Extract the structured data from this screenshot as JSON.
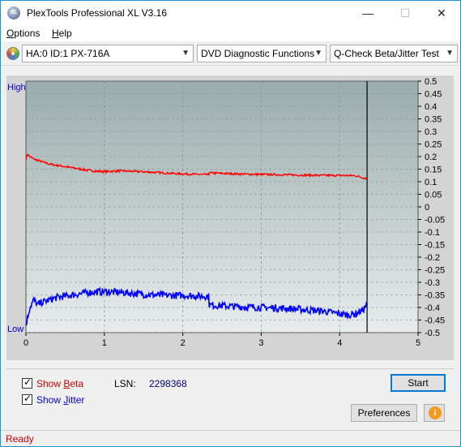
{
  "window": {
    "title": "PlexTools Professional XL V3.16",
    "icon_text": "XL",
    "minimize": "—",
    "maximize": "☐",
    "close": "✕"
  },
  "menu": {
    "items": [
      {
        "label": "Options",
        "accel": "O"
      },
      {
        "label": "Help",
        "accel": "H"
      }
    ]
  },
  "toolbar": {
    "drive": "HA:0 ID:1  PX-716A",
    "function": "DVD Diagnostic Functions",
    "test": "Q-Check Beta/Jitter Test",
    "arrow": "▼"
  },
  "chart_labels": {
    "high": "High",
    "low": "Low"
  },
  "chart_data": {
    "type": "line",
    "x_ticks": [
      0,
      1,
      2,
      3,
      4,
      5
    ],
    "y_ticks_right": [
      0.5,
      0.45,
      0.4,
      0.35,
      0.3,
      0.25,
      0.2,
      0.15,
      0.1,
      0.05,
      0,
      -0.05,
      -0.1,
      -0.15,
      -0.2,
      -0.25,
      -0.3,
      -0.35,
      -0.4,
      -0.45,
      -0.5
    ],
    "xlim": [
      0,
      5
    ],
    "ylim": [
      -0.5,
      0.5
    ],
    "end_marker_x": 4.35,
    "grid": true,
    "series": [
      {
        "key": "beta",
        "color": "#ff0000",
        "x": [
          0.0,
          0.02,
          0.05,
          0.1,
          0.15,
          0.2,
          0.3,
          0.4,
          0.5,
          0.6,
          0.7,
          0.8,
          0.9,
          1.0,
          1.2,
          1.4,
          1.6,
          1.8,
          2.0,
          2.2,
          2.33,
          2.34,
          2.6,
          2.8,
          3.0,
          3.2,
          3.4,
          3.6,
          3.8,
          4.0,
          4.2,
          4.35
        ],
        "y": [
          0.19,
          0.21,
          0.2,
          0.19,
          0.185,
          0.18,
          0.17,
          0.165,
          0.16,
          0.155,
          0.15,
          0.145,
          0.142,
          0.14,
          0.143,
          0.141,
          0.138,
          0.134,
          0.131,
          0.129,
          0.128,
          0.135,
          0.132,
          0.13,
          0.129,
          0.128,
          0.127,
          0.126,
          0.125,
          0.125,
          0.124,
          0.112
        ]
      },
      {
        "key": "jitter",
        "color": "#0000ff",
        "x": [
          0.0,
          0.02,
          0.05,
          0.1,
          0.15,
          0.2,
          0.3,
          0.4,
          0.5,
          0.6,
          0.7,
          0.8,
          0.9,
          1.0,
          1.2,
          1.4,
          1.6,
          1.8,
          2.0,
          2.2,
          2.33,
          2.34,
          2.6,
          2.8,
          3.0,
          3.2,
          3.4,
          3.6,
          3.8,
          4.0,
          4.1,
          4.2,
          4.3,
          4.35
        ],
        "y": [
          -0.47,
          -0.44,
          -0.4,
          -0.37,
          -0.39,
          -0.38,
          -0.37,
          -0.36,
          -0.355,
          -0.35,
          -0.345,
          -0.34,
          -0.338,
          -0.337,
          -0.34,
          -0.345,
          -0.35,
          -0.352,
          -0.352,
          -0.355,
          -0.356,
          -0.39,
          -0.395,
          -0.398,
          -0.4,
          -0.402,
          -0.405,
          -0.41,
          -0.415,
          -0.425,
          -0.43,
          -0.425,
          -0.41,
          -0.385
        ]
      }
    ]
  },
  "controls": {
    "show_beta_label": "Show Beta",
    "show_beta_accel": "B",
    "show_beta_checked": true,
    "show_jitter_label": "Show Jitter",
    "show_jitter_accel": "J",
    "show_jitter_checked": true,
    "lsn_label": "LSN:",
    "lsn_value": "2298368",
    "start_label": "Start",
    "preferences_label": "Preferences",
    "info_icon": "i"
  },
  "status": {
    "text": "Ready"
  },
  "colors": {
    "beta": "#ff0000",
    "jitter": "#0000ff",
    "plot_bg_top": "#9aacac",
    "plot_bg_bottom": "#e8ecec",
    "status_text": "#cc0000",
    "accent": "#0078d7"
  }
}
